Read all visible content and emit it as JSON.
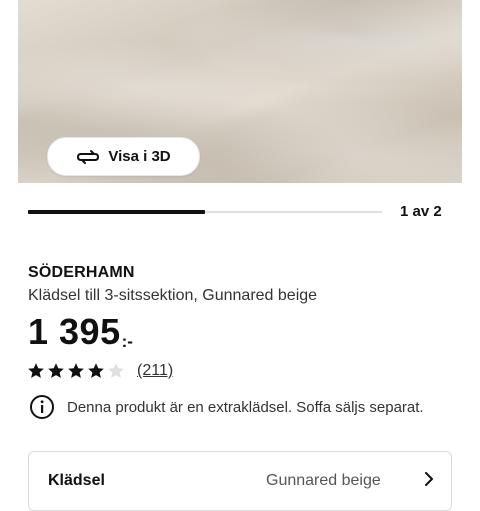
{
  "gallery": {
    "view_3d_label": "Visa i 3D",
    "current_image": 1,
    "total_images": 2,
    "page_indicator": "1 av 2",
    "progress_fraction": 0.5
  },
  "product": {
    "name": "SÖDERHAMN",
    "description": "Klädsel till 3-sitssektion, Gunnared beige",
    "price_main": "1 395",
    "price_suffix": ":-",
    "rating": {
      "value": 4,
      "max": 5,
      "review_count": "(211)"
    },
    "info_text": "Denna produkt är en extraklädsel. Soffa säljs separat."
  },
  "option_card": {
    "label": "Klädsel",
    "value": "Gunnared beige"
  },
  "icons": {
    "view3d": "rotate-3d-icon",
    "info": "info-circle-icon",
    "star": "star-icon",
    "chevron": "chevron-right-icon"
  },
  "colors": {
    "text": "#111111",
    "star_filled": "#111111",
    "star_empty": "#dfdfdf"
  }
}
